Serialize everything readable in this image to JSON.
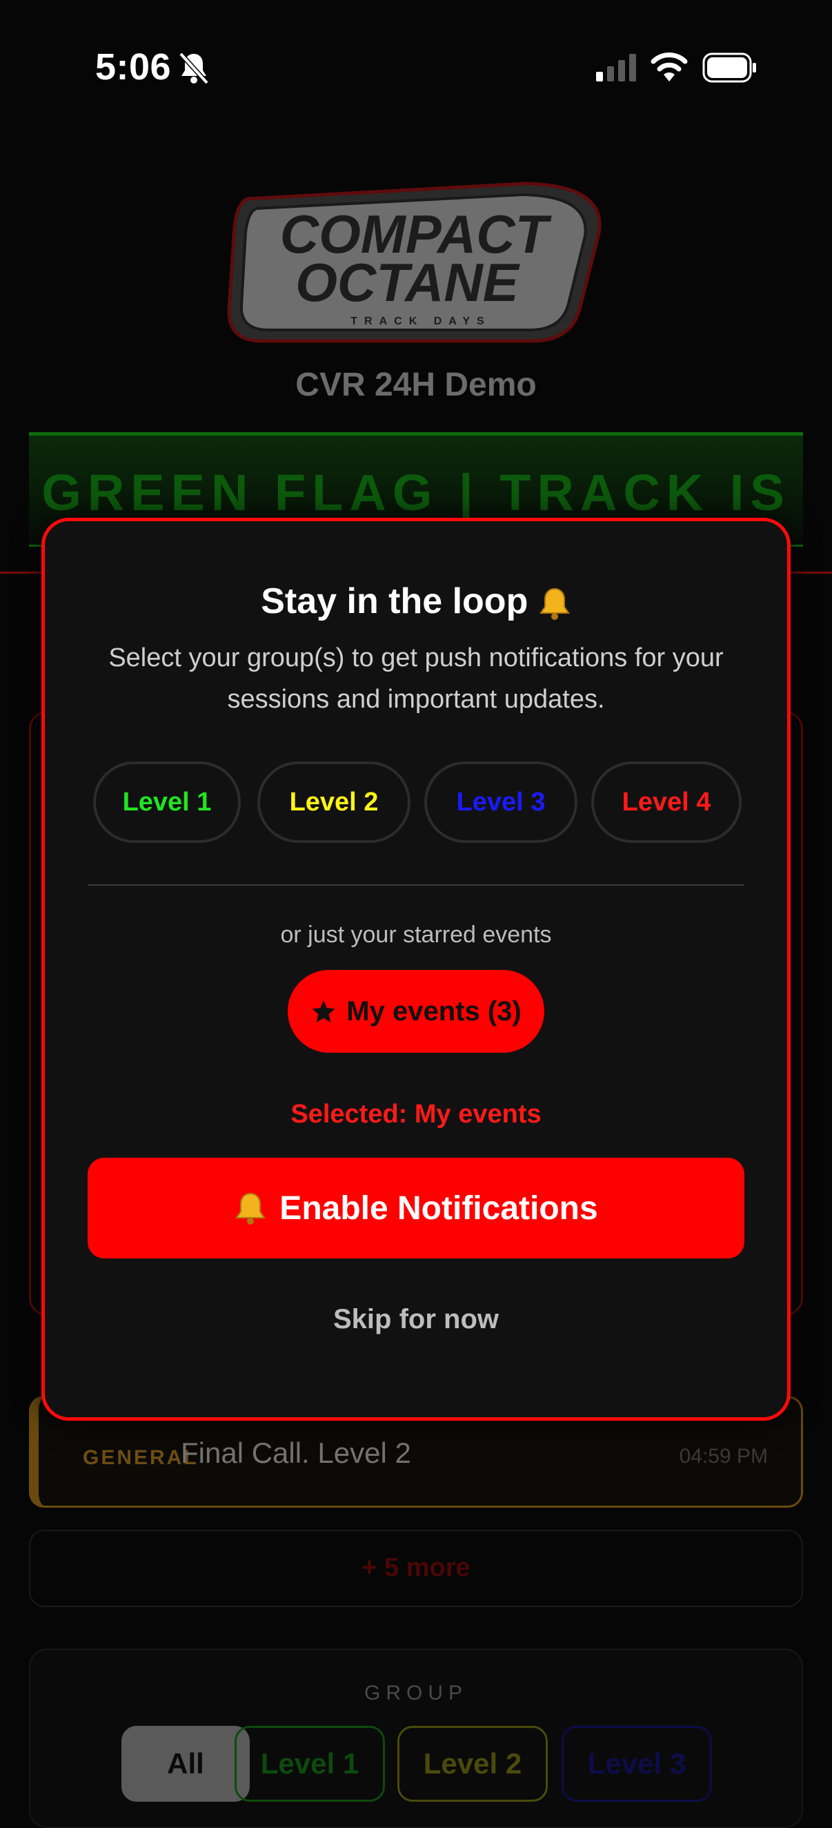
{
  "status_bar": {
    "time": "5:06",
    "icons": [
      "bell-slash-icon",
      "signal-icon",
      "wifi-icon",
      "battery-icon"
    ]
  },
  "header": {
    "logo_text": [
      "COMPACT",
      "OCTANE",
      "TRACK DAYS"
    ],
    "event_name": "CVR 24H Demo"
  },
  "flag_banner": {
    "text": "GREEN FLAG | TRACK IS HOT",
    "color": "#0c6a0c"
  },
  "modal": {
    "title": "Stay in the loop",
    "description": "Select your group(s) to get push notifications for your sessions and important updates.",
    "levels": [
      {
        "label": "Level 1",
        "color": "#20e520"
      },
      {
        "label": "Level 2",
        "color": "#fff515"
      },
      {
        "label": "Level 3",
        "color": "#1a1aff"
      },
      {
        "label": "Level 4",
        "color": "#ff1a1a"
      }
    ],
    "starred_hint": "or just your starred events",
    "my_events_label": "My events (3)",
    "selected_text": "Selected: My events",
    "enable_label": "Enable Notifications",
    "skip_label": "Skip for now",
    "accent": "#ff0000"
  },
  "announcement": {
    "tag": "GENERAL",
    "text": "Final Call. Level 2",
    "time": "04:59 PM"
  },
  "more": {
    "label": "+ 5 more"
  },
  "group_filter": {
    "label": "GROUP",
    "chips": [
      "All",
      "Level 1",
      "Level 2",
      "Level 3"
    ]
  }
}
